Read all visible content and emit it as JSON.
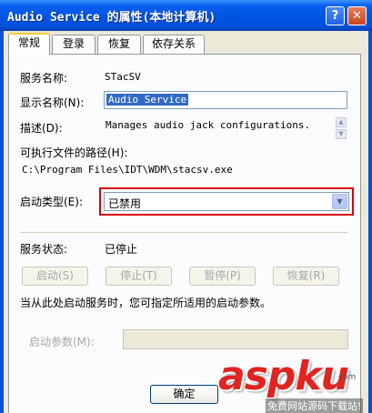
{
  "window": {
    "title": "Audio Service 的属性(本地计算机)",
    "help_label": "?",
    "close_label": "✕"
  },
  "tabs": [
    {
      "label": "常规",
      "active": true
    },
    {
      "label": "登录",
      "active": false
    },
    {
      "label": "恢复",
      "active": false
    },
    {
      "label": "依存关系",
      "active": false
    }
  ],
  "general": {
    "service_name_label": "服务名称:",
    "service_name_value": "STacSV",
    "display_name_label": "显示名称(N):",
    "display_name_value": "Audio Service",
    "description_label": "描述(D):",
    "description_value": "Manages audio jack configurations.",
    "exe_path_label": "可执行文件的路径(H):",
    "exe_path_value": "C:\\Program Files\\IDT\\WDM\\stacsv.exe",
    "startup_type_label": "启动类型(E):",
    "startup_type_value": "已禁用",
    "service_status_label": "服务状态:",
    "service_status_value": "已停止",
    "buttons": {
      "start": "启动(S)",
      "stop": "停止(T)",
      "pause": "暂停(P)",
      "resume": "恢复(R)"
    },
    "hint": "当从此处启动服务时，您可指定所适用的启动参数。",
    "start_params_label": "启动参数(M):",
    "start_params_value": ""
  },
  "footer": {
    "ok_label": "确定"
  },
  "watermark": {
    "brand": "aspku",
    "suffix": "com",
    "subtitle": "免费网站源码下载站!"
  },
  "colors": {
    "titlebar": "#0054E3",
    "highlight_box": "#D8000C",
    "selection": "#316AC5",
    "watermark": "#E02420"
  }
}
